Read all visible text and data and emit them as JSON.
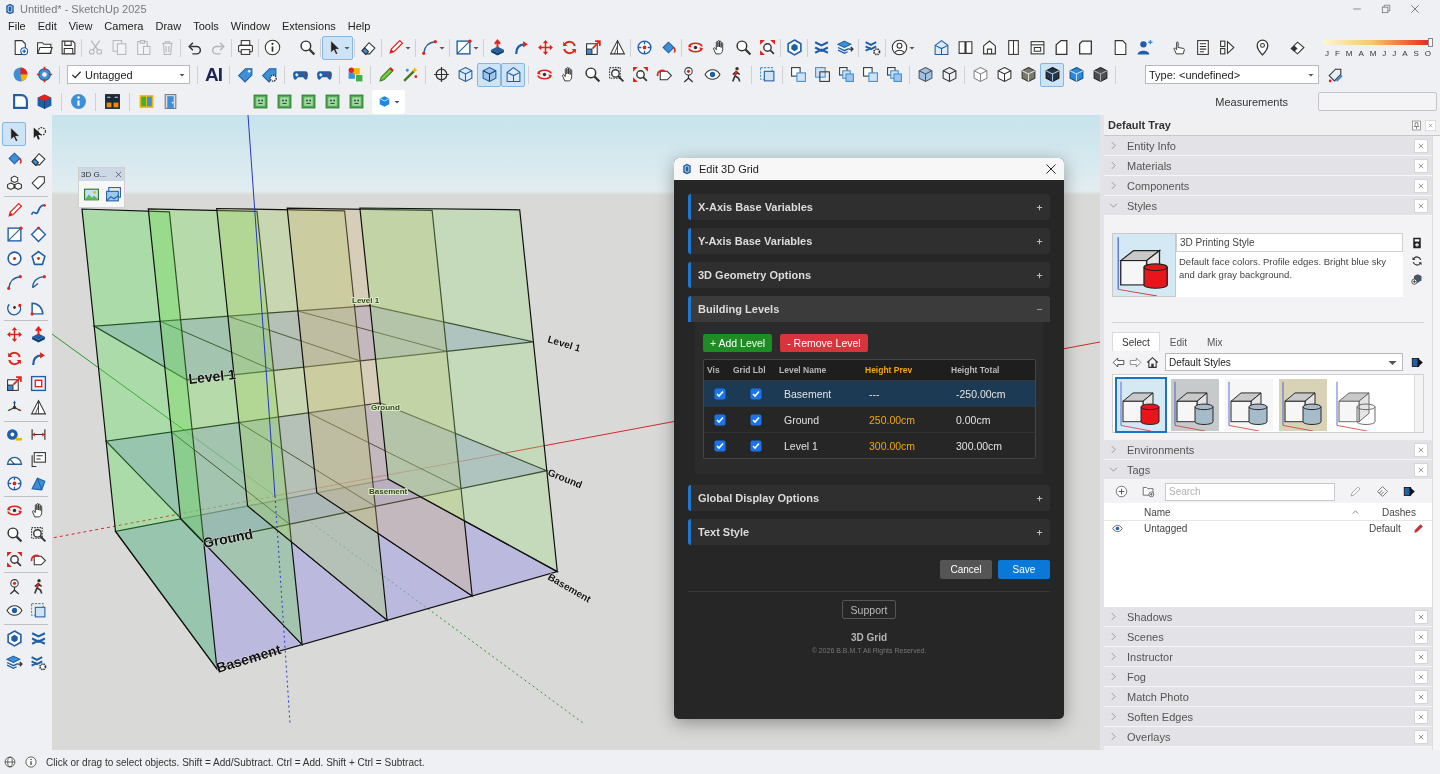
{
  "window": {
    "title": "Untitled* - SketchUp 2025"
  },
  "menu_bar": [
    "File",
    "Edit",
    "View",
    "Camera",
    "Draw",
    "Tools",
    "Window",
    "Extensions",
    "Help"
  ],
  "toolbar_row_1": {
    "buttons": [
      {
        "selected": false,
        "disabled": false
      },
      {
        "selected": false,
        "disabled": false
      },
      {
        "selected": false,
        "disabled": false
      },
      {
        "selected": false,
        "disabled": true
      },
      {
        "selected": false,
        "disabled": true
      },
      {
        "selected": false,
        "disabled": true
      },
      {
        "selected": false,
        "disabled": true
      },
      {
        "selected": false,
        "disabled": false
      },
      {
        "selected": false,
        "disabled": true
      },
      {
        "selected": false,
        "disabled": false
      },
      {
        "selected": false,
        "disabled": false
      },
      {
        "selected": false,
        "disabled": false
      },
      {
        "selected": true,
        "disabled": false
      },
      {
        "selected": false,
        "disabled": false
      },
      {
        "selected": false,
        "disabled": false
      },
      {
        "selected": false,
        "disabled": false
      },
      {
        "selected": false,
        "disabled": false
      },
      {
        "selected": false,
        "disabled": false
      },
      {
        "selected": false,
        "disabled": false
      },
      {
        "selected": false,
        "disabled": false
      },
      {
        "selected": false,
        "disabled": false
      },
      {
        "selected": false,
        "disabled": false
      },
      {
        "selected": false,
        "disabled": false
      },
      {
        "selected": false,
        "disabled": false
      },
      {
        "selected": false,
        "disabled": false
      },
      {
        "selected": false,
        "disabled": false
      },
      {
        "selected": false,
        "disabled": false
      },
      {
        "selected": false,
        "disabled": false
      },
      {
        "selected": false,
        "disabled": false
      },
      {
        "selected": false,
        "disabled": false
      },
      {
        "selected": false,
        "disabled": false
      },
      {
        "selected": false,
        "disabled": false
      },
      {
        "selected": false,
        "disabled": false
      },
      {
        "selected": false,
        "disabled": false
      },
      {
        "selected": false,
        "disabled": false
      },
      {
        "selected": false,
        "disabled": false
      },
      {
        "selected": false,
        "disabled": false
      },
      {
        "selected": false,
        "disabled": false
      },
      {
        "selected": false,
        "disabled": false
      },
      {
        "selected": false,
        "disabled": false
      },
      {
        "selected": false,
        "disabled": false
      },
      {
        "selected": false,
        "disabled": false
      },
      {
        "selected": false,
        "disabled": false
      },
      {
        "selected": false,
        "disabled": false
      },
      {
        "selected": false,
        "disabled": false
      },
      {
        "selected": false,
        "disabled": false
      },
      {
        "selected": false,
        "disabled": false
      },
      {
        "selected": false,
        "disabled": false
      }
    ],
    "shadow_slider": {
      "level": 1,
      "months": [
        "J",
        "F",
        "M",
        "A",
        "M",
        "J",
        "J",
        "A",
        "S",
        "O"
      ]
    }
  },
  "toolbar_row_2": {
    "buttons": [
      {
        "selected": false
      },
      {
        "selected": false
      },
      {
        "selected": false
      },
      {
        "selected": false
      },
      {
        "selected": false
      },
      {
        "selected": false
      },
      {
        "selected": false
      },
      {
        "selected": false
      },
      {
        "selected": false
      },
      {
        "selected": false
      },
      {
        "selected": false
      },
      {
        "selected": true
      },
      {
        "selected": true
      },
      {
        "selected": false
      },
      {
        "selected": false
      },
      {
        "selected": false
      },
      {
        "selected": false
      },
      {
        "selected": false
      },
      {
        "selected": false
      },
      {
        "selected": false
      },
      {
        "selected": false
      },
      {
        "selected": false
      },
      {
        "selected": false
      },
      {
        "selected": false
      },
      {
        "selected": false
      },
      {
        "selected": false
      },
      {
        "selected": false
      },
      {
        "selected": false
      },
      {
        "selected": false
      },
      {
        "selected": false
      },
      {
        "selected": false
      },
      {
        "selected": false
      },
      {
        "selected": false
      },
      {
        "selected": true
      },
      {
        "selected": false
      },
      {
        "selected": false
      },
      {
        "selected": false
      }
    ],
    "tag_dropdown": {
      "value": "Untagged"
    },
    "ai_button": {
      "label": "AI"
    },
    "type_dropdown": {
      "value": "Type: <undefined>"
    }
  },
  "toolbar_row_3": {
    "measurements": {
      "label": "Measurements"
    }
  },
  "left_toolbar": [
    {
      "selected": true
    },
    {
      "selected": false
    },
    {
      "selected": false
    },
    {
      "selected": false
    },
    {
      "selected": false
    },
    {
      "selected": false
    },
    {
      "selected": false
    },
    {
      "selected": false
    },
    {
      "selected": false
    },
    {
      "selected": false
    },
    {
      "selected": false
    },
    {
      "selected": false
    },
    {
      "selected": false
    },
    {
      "selected": false
    },
    {
      "selected": false
    },
    {
      "selected": false
    },
    {
      "selected": false
    },
    {
      "selected": false
    },
    {
      "selected": false
    },
    {
      "selected": false
    },
    {
      "selected": false
    },
    {
      "selected": false
    },
    {
      "selected": false
    },
    {
      "selected": false
    },
    {
      "selected": false
    },
    {
      "selected": false
    },
    {
      "selected": false
    },
    {
      "selected": false
    },
    {
      "selected": false
    },
    {
      "selected": false
    },
    {
      "selected": false
    },
    {
      "selected": false
    },
    {
      "selected": false
    },
    {
      "selected": false
    },
    {
      "selected": false
    },
    {
      "selected": false
    },
    {
      "selected": false
    },
    {
      "selected": false
    },
    {
      "selected": false
    },
    {
      "selected": false
    },
    {
      "selected": false
    },
    {
      "selected": false
    },
    {
      "selected": false
    },
    {
      "selected": false
    }
  ],
  "floating_toolbar": {
    "title": "3D G..."
  },
  "viewport": {
    "labels": [
      {
        "text": "Level 1",
        "kind": "front"
      },
      {
        "text": "Ground",
        "kind": "front"
      },
      {
        "text": "Basement",
        "kind": "front"
      },
      {
        "text": "Level 1",
        "kind": "side"
      },
      {
        "text": "Ground",
        "kind": "side"
      },
      {
        "text": "Basement",
        "kind": "side"
      },
      {
        "text": "Level 1",
        "kind": "back"
      },
      {
        "text": "Ground",
        "kind": "back"
      },
      {
        "text": "Basement",
        "kind": "back"
      }
    ]
  },
  "dialog": {
    "title": "Edit 3D Grid",
    "sections": [
      {
        "title": "X-Axis Base Variables",
        "expanded": false
      },
      {
        "title": "Y-Axis Base Variables",
        "expanded": false
      },
      {
        "title": "3D Geometry Options",
        "expanded": false
      },
      {
        "title": "Building Levels",
        "expanded": true,
        "actions": [
          {
            "label": "+ Add Level",
            "kind": "add"
          },
          {
            "label": "- Remove Level",
            "kind": "remove"
          }
        ],
        "table": {
          "columns": [
            {
              "label": "Vis",
              "highlighted": false
            },
            {
              "label": "Grid Lbl",
              "highlighted": false
            },
            {
              "label": "Level Name",
              "highlighted": false
            },
            {
              "label": "Height Prev",
              "highlighted": true
            },
            {
              "label": "Height Total",
              "highlighted": false
            }
          ],
          "rows": [
            {
              "visible": true,
              "grid_label": true,
              "name": "Basement",
              "height_prev": "---",
              "height_total": "-250.00cm",
              "selected": true
            },
            {
              "visible": true,
              "grid_label": true,
              "name": "Ground",
              "height_prev": "250.00cm",
              "height_total": "0.00cm",
              "selected": false
            },
            {
              "visible": true,
              "grid_label": true,
              "name": "Level 1",
              "height_prev": "300.00cm",
              "height_total": "300.00cm",
              "selected": false
            }
          ]
        }
      },
      {
        "title": "Global Display Options",
        "expanded": false
      },
      {
        "title": "Text Style",
        "expanded": false
      }
    ],
    "buttons": [
      {
        "label": "Cancel",
        "kind": "secondary"
      },
      {
        "label": "Save",
        "kind": "primary"
      }
    ],
    "support_button": "Support",
    "product_name": "3D Grid",
    "copyright": "© 2026 B.B.M.T All Rights Reserved."
  },
  "tray": {
    "title": "Default Tray",
    "panels": [
      {
        "kind": "plain",
        "title": "Entity Info",
        "expanded": false
      },
      {
        "kind": "plain",
        "title": "Materials",
        "expanded": false
      },
      {
        "kind": "plain",
        "title": "Components",
        "expanded": false
      },
      {
        "kind": "styles",
        "title": "Styles",
        "expanded": true,
        "style_name": "3D Printing Style",
        "description": "Default face colors. Profile edges. Bright blue sky and dark gray background.",
        "tabs": [
          {
            "label": "Select",
            "selected": true
          },
          {
            "label": "Edit",
            "selected": false
          },
          {
            "label": "Mix",
            "selected": false
          }
        ],
        "collection": "Default Styles",
        "thumbnails": [
          {
            "kind": "color",
            "selected": true
          },
          {
            "kind": "gray",
            "selected": false
          },
          {
            "kind": "white",
            "selected": false
          },
          {
            "kind": "tan",
            "selected": false
          },
          {
            "kind": "sketch",
            "selected": false
          }
        ]
      },
      {
        "kind": "plain",
        "title": "Environments",
        "expanded": false
      },
      {
        "kind": "tags",
        "title": "Tags",
        "expanded": true,
        "search": {
          "placeholder": "Search"
        },
        "columns": [
          "Name",
          "Dashes"
        ],
        "rows": [
          {
            "name": "Untagged",
            "dashes": "Default",
            "visible": true
          }
        ]
      },
      {
        "kind": "plain",
        "title": "Shadows",
        "expanded": false
      },
      {
        "kind": "plain",
        "title": "Scenes",
        "expanded": false
      },
      {
        "kind": "plain",
        "title": "Instructor",
        "expanded": false
      },
      {
        "kind": "plain",
        "title": "Fog",
        "expanded": false
      },
      {
        "kind": "plain",
        "title": "Match Photo",
        "expanded": false
      },
      {
        "kind": "plain",
        "title": "Soften Edges",
        "expanded": false
      },
      {
        "kind": "plain",
        "title": "Overlays",
        "expanded": false
      }
    ]
  },
  "status_bar": {
    "text": "Click or drag to select objects. Shift = Add/Subtract. Ctrl = Add. Shift + Ctrl = Subtract."
  }
}
